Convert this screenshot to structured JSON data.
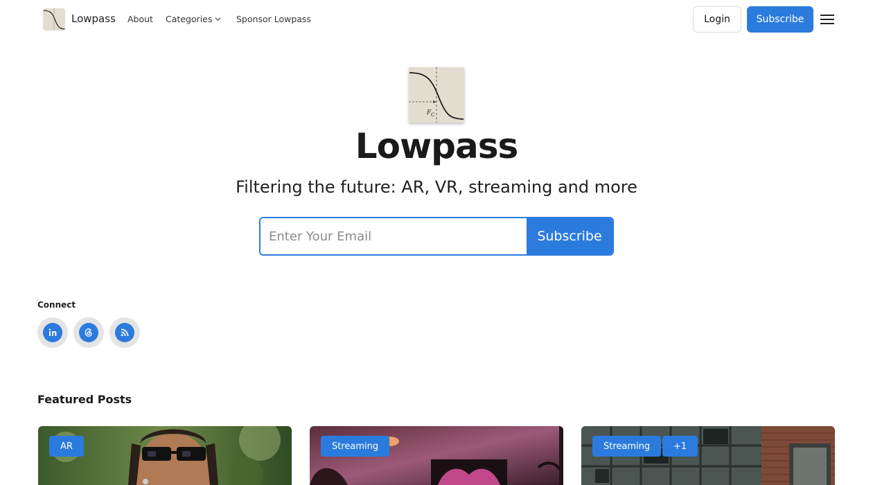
{
  "nav": {
    "brand": "Lowpass",
    "links": [
      "About",
      "Categories",
      "Sponsor Lowpass"
    ],
    "login_label": "Login",
    "subscribe_label": "Subscribe"
  },
  "hero": {
    "title": "Lowpass",
    "subtitle": "Filtering the future: AR, VR, streaming and more",
    "email_placeholder": "Enter Your Email",
    "subscribe_label": "Subscribe"
  },
  "connect": {
    "label": "Connect",
    "icons": [
      "linkedin-icon",
      "threads-icon",
      "rss-icon"
    ]
  },
  "featured": {
    "title": "Featured Posts",
    "cards": [
      {
        "tags": [
          "AR"
        ]
      },
      {
        "tags": [
          "Streaming"
        ]
      },
      {
        "tags": [
          "Streaming",
          "+1"
        ]
      }
    ]
  },
  "colors": {
    "accent": "#2b7bde",
    "logo_bg": "#e3ddcf"
  }
}
